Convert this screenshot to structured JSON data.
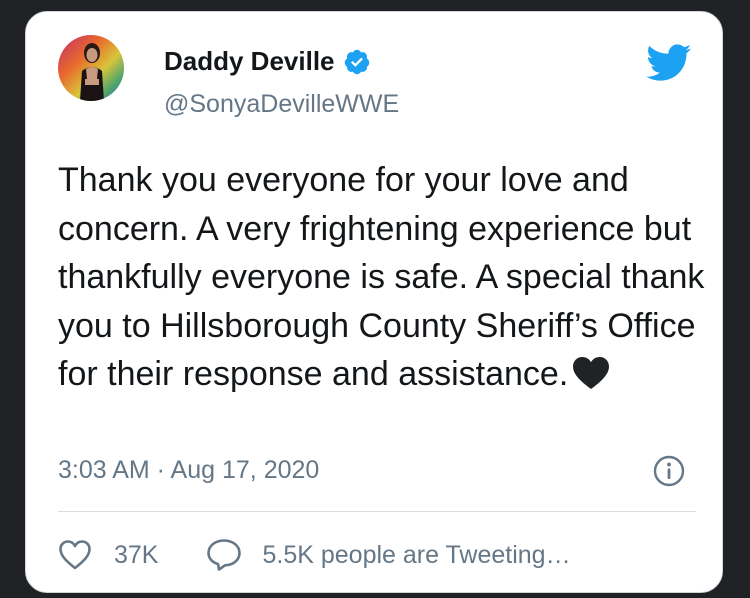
{
  "tweet": {
    "author": {
      "display_name": "Daddy Deville",
      "handle": "@SonyaDevilleWWE",
      "verified": true
    },
    "text": "Thank you everyone for your love and concern. A very frightening experience but thankfully everyone is safe. A special thank you to Hillsborough County Sheriff’s Office for their response and assistance.",
    "emoji": "black-heart",
    "timestamp": "3:03 AM · Aug 17, 2020",
    "likes": "37K",
    "tweeting": "5.5K people are Tweeting…"
  },
  "icons": {
    "brand": "twitter-bird-icon",
    "verified": "verified-badge-icon",
    "info": "info-icon",
    "like": "heart-outline-icon",
    "reply": "speech-bubble-icon"
  },
  "colors": {
    "accent": "#1da1f2",
    "text": "#14171a",
    "secondary": "#657786",
    "background": "#1f2124",
    "card": "#ffffff"
  }
}
